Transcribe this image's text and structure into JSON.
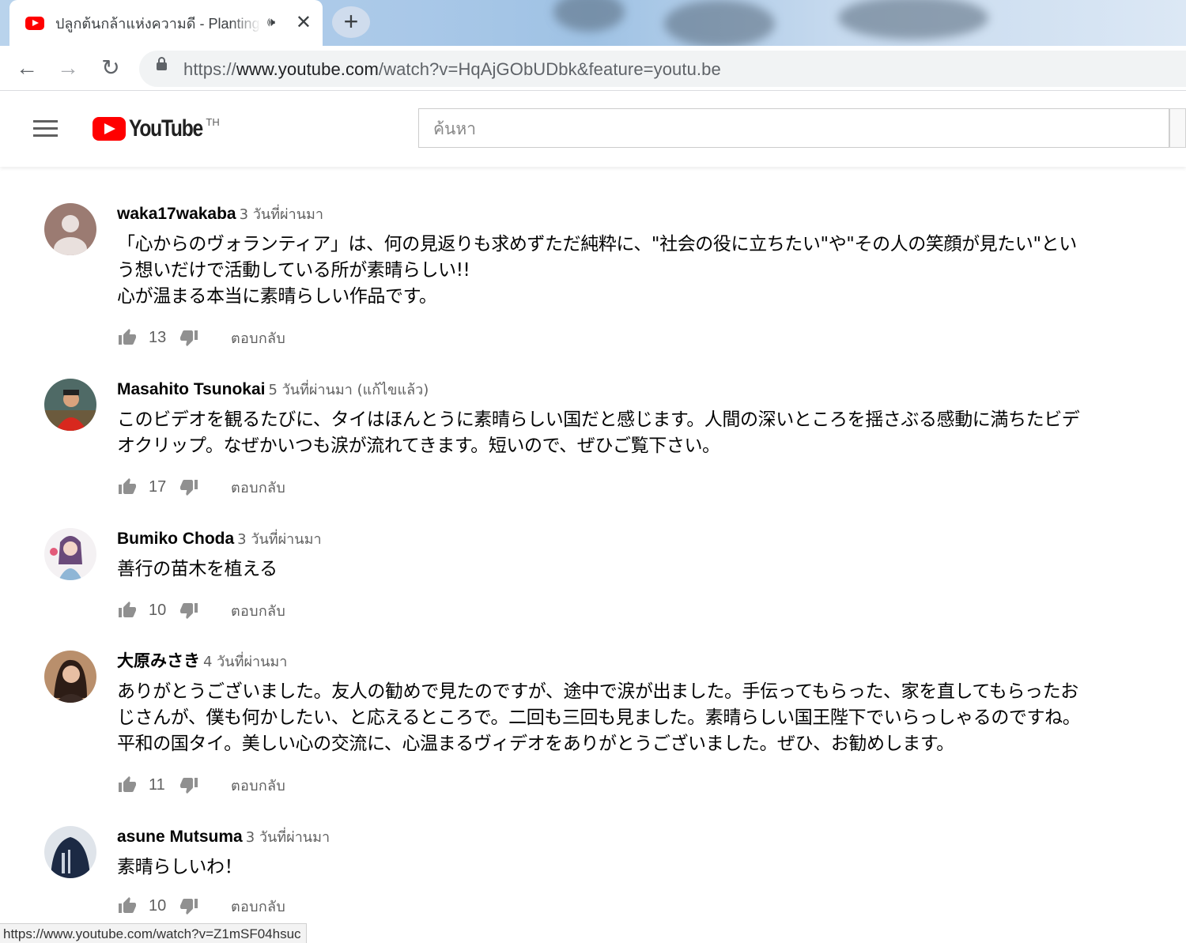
{
  "browser": {
    "tab_title": "ปลูกต้นกล้าแห่งความดี - Planting",
    "speaker_icon": "🕪",
    "close_icon": "✕",
    "new_tab_icon": "+",
    "url_prefix": "https://",
    "url_host": "www.youtube.com",
    "url_rest": "/watch?v=HqAjGObUDbk&feature=youtu.be",
    "back_icon": "←",
    "forward_icon": "→",
    "reload_icon": "↻"
  },
  "masthead": {
    "logo_text": "YouTube",
    "country_code": "TH",
    "search_placeholder": "ค้นหา"
  },
  "comments": [
    {
      "author": "waka17wakaba",
      "time": "3 วันที่ผ่านมา",
      "text": "「心からのヴォランティア」は、何の見返りも求めずただ純粋に、\"社会の役に立ちたい\"や\"その人の笑顔が見たい\"とい\nう想いだけで活動している所が素晴らしい!!\n心が温まる本当に素晴らしい作品です。",
      "likes": "13",
      "reply": "ตอบกลับ"
    },
    {
      "author": "Masahito Tsunokai",
      "time": "5 วันที่ผ่านมา (แก้ไขแล้ว)",
      "text": "このビデオを観るたびに、タイはほんとうに素晴らしい国だと感じます。人間の深いところを揺さぶる感動に満ちたビデ\nオクリップ。なぜかいつも涙が流れてきます。短いので、ぜひご覧下さい。",
      "likes": "17",
      "reply": "ตอบกลับ"
    },
    {
      "author": "Bumiko Choda",
      "time": "3 วันที่ผ่านมา",
      "text": "善行の苗木を植える",
      "likes": "10",
      "reply": "ตอบกลับ"
    },
    {
      "author": "大原みさき",
      "time": "4 วันที่ผ่านมา",
      "text": "ありがとうございました。友人の勧めで見たのですが、途中で涙が出ました。手伝ってもらった、家を直してもらったお\nじさんが、僕も何かしたい、と応えるところで。二回も三回も見ました。素晴らしい国王陛下でいらっしゃるのですね。\n平和の国タイ。美しい心の交流に、心温まるヴィデオをありがとうございました。ぜひ、お勧めします。",
      "likes": "11",
      "reply": "ตอบกลับ"
    },
    {
      "author": "asune Mutsuma",
      "time": "3 วันที่ผ่านมา",
      "text": "素晴らしいわ！",
      "likes": "10",
      "reply": "ตอบกลับ"
    }
  ],
  "status_url": "https://www.youtube.com/watch?v=Z1mSF04hsuc",
  "colors": {
    "brand_red": "#ff0000",
    "text_primary": "#030303",
    "text_secondary": "#606060"
  }
}
